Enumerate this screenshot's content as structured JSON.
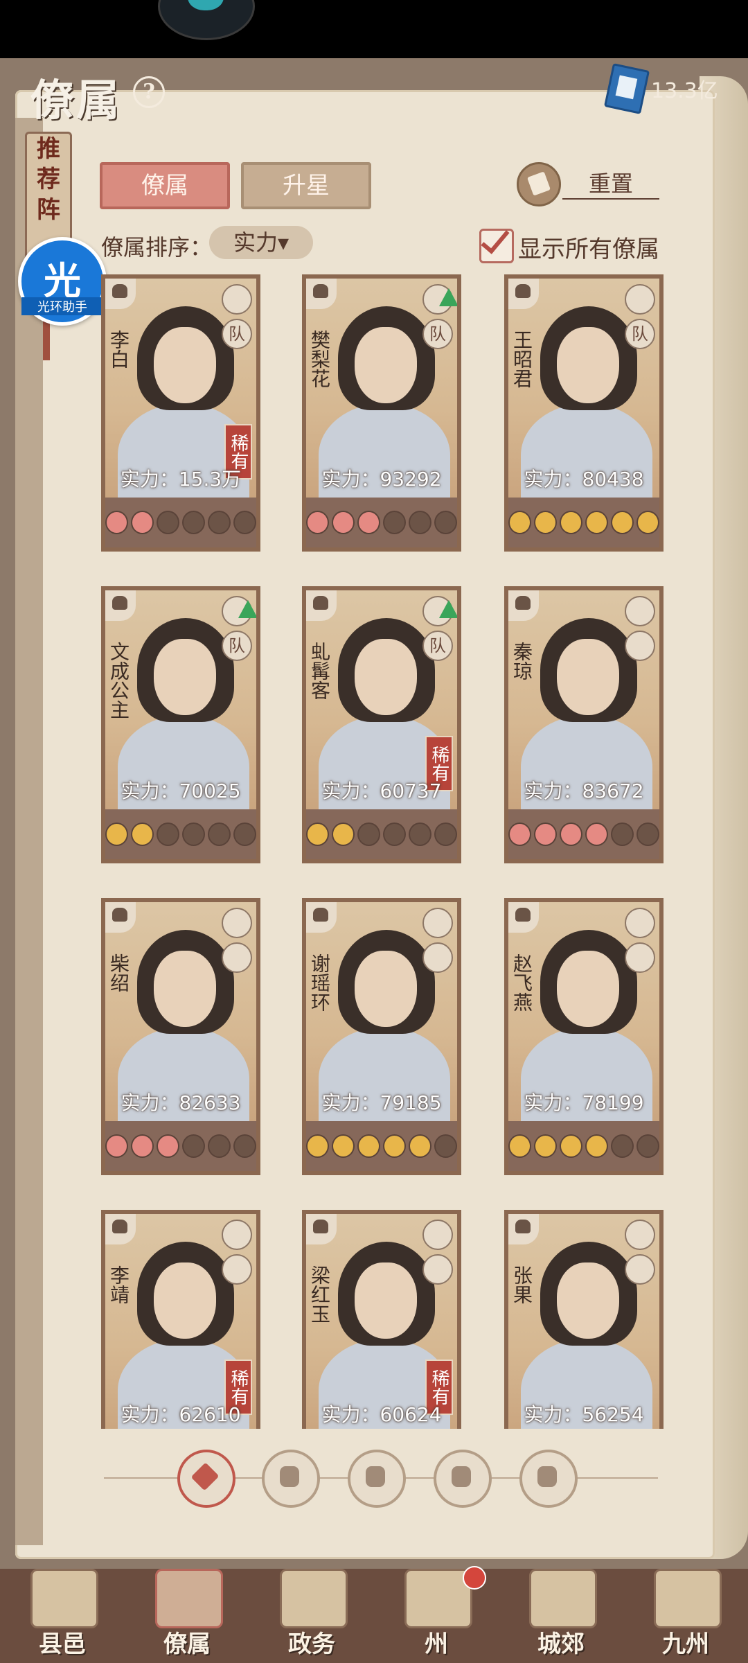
{
  "header": {
    "title": "僚属",
    "help_glyph": "?",
    "currency_value": "13.3亿"
  },
  "side_tab": {
    "label_chars": [
      "推",
      "荐",
      "阵"
    ]
  },
  "helper_badge": {
    "glyph": "光",
    "label": "光环助手"
  },
  "tabs": [
    {
      "label": "僚属",
      "active": true
    },
    {
      "label": "升星",
      "active": false
    }
  ],
  "reset_label": "重置",
  "sort": {
    "label": "僚属排序：",
    "value": "实力▾"
  },
  "show_all": {
    "label": "显示所有僚属",
    "checked": true
  },
  "colors": {
    "accent_red": "#b7443a",
    "active_tab": "#d98c80",
    "star_red": "#e58a83",
    "star_gold": "#e8b64a"
  },
  "cards": [
    {
      "name": "李白",
      "power": "实力：15.3万",
      "rare": "稀有",
      "team": "队",
      "stars": [
        "red",
        "red",
        "empty",
        "empty",
        "empty",
        "empty"
      ],
      "upgrade": false
    },
    {
      "name": "樊梨花",
      "power": "实力：93292",
      "rare": "",
      "team": "队",
      "stars": [
        "red",
        "red",
        "red",
        "empty",
        "empty",
        "empty"
      ],
      "upgrade": true
    },
    {
      "name": "王昭君",
      "power": "实力：80438",
      "rare": "",
      "team": "队",
      "stars": [
        "gold",
        "gold",
        "gold",
        "gold",
        "gold",
        "gold"
      ],
      "upgrade": false
    },
    {
      "name": "文成公主",
      "power": "实力：70025",
      "rare": "",
      "team": "队",
      "stars": [
        "gold",
        "gold",
        "empty",
        "empty",
        "empty",
        "empty"
      ],
      "upgrade": true
    },
    {
      "name": "虬髯客",
      "power": "实力：60737",
      "rare": "稀有",
      "team": "队",
      "stars": [
        "gold",
        "gold",
        "empty",
        "empty",
        "empty",
        "empty"
      ],
      "upgrade": true
    },
    {
      "name": "秦琼",
      "power": "实力：83672",
      "rare": "",
      "team": "",
      "stars": [
        "red",
        "red",
        "red",
        "red",
        "empty",
        "empty"
      ],
      "upgrade": false
    },
    {
      "name": "柴绍",
      "power": "实力：82633",
      "rare": "",
      "team": "",
      "stars": [
        "red",
        "red",
        "red",
        "empty",
        "empty",
        "empty"
      ],
      "upgrade": false
    },
    {
      "name": "谢瑶环",
      "power": "实力：79185",
      "rare": "",
      "team": "",
      "stars": [
        "gold",
        "gold",
        "gold",
        "gold",
        "gold",
        "empty"
      ],
      "upgrade": false
    },
    {
      "name": "赵飞燕",
      "power": "实力：78199",
      "rare": "",
      "team": "",
      "stars": [
        "gold",
        "gold",
        "gold",
        "gold",
        "empty",
        "empty"
      ],
      "upgrade": false
    },
    {
      "name": "李靖",
      "power": "实力：62610",
      "rare": "稀有",
      "team": "",
      "stars": [],
      "upgrade": false
    },
    {
      "name": "梁红玉",
      "power": "实力：60624",
      "rare": "稀有",
      "team": "",
      "stars": [],
      "upgrade": false
    },
    {
      "name": "张果",
      "power": "实力：56254",
      "rare": "",
      "team": "",
      "stars": [],
      "upgrade": false
    }
  ],
  "filters": [
    "all-filter-icon",
    "helmet-filter-icon",
    "gourd-filter-icon",
    "fan-filter-icon",
    "lion-filter-icon"
  ],
  "bottom_nav": [
    {
      "label": "县邑"
    },
    {
      "label": "僚属"
    },
    {
      "label": "政务"
    },
    {
      "label": "州"
    },
    {
      "label": "城郊"
    },
    {
      "label": "九州"
    }
  ]
}
